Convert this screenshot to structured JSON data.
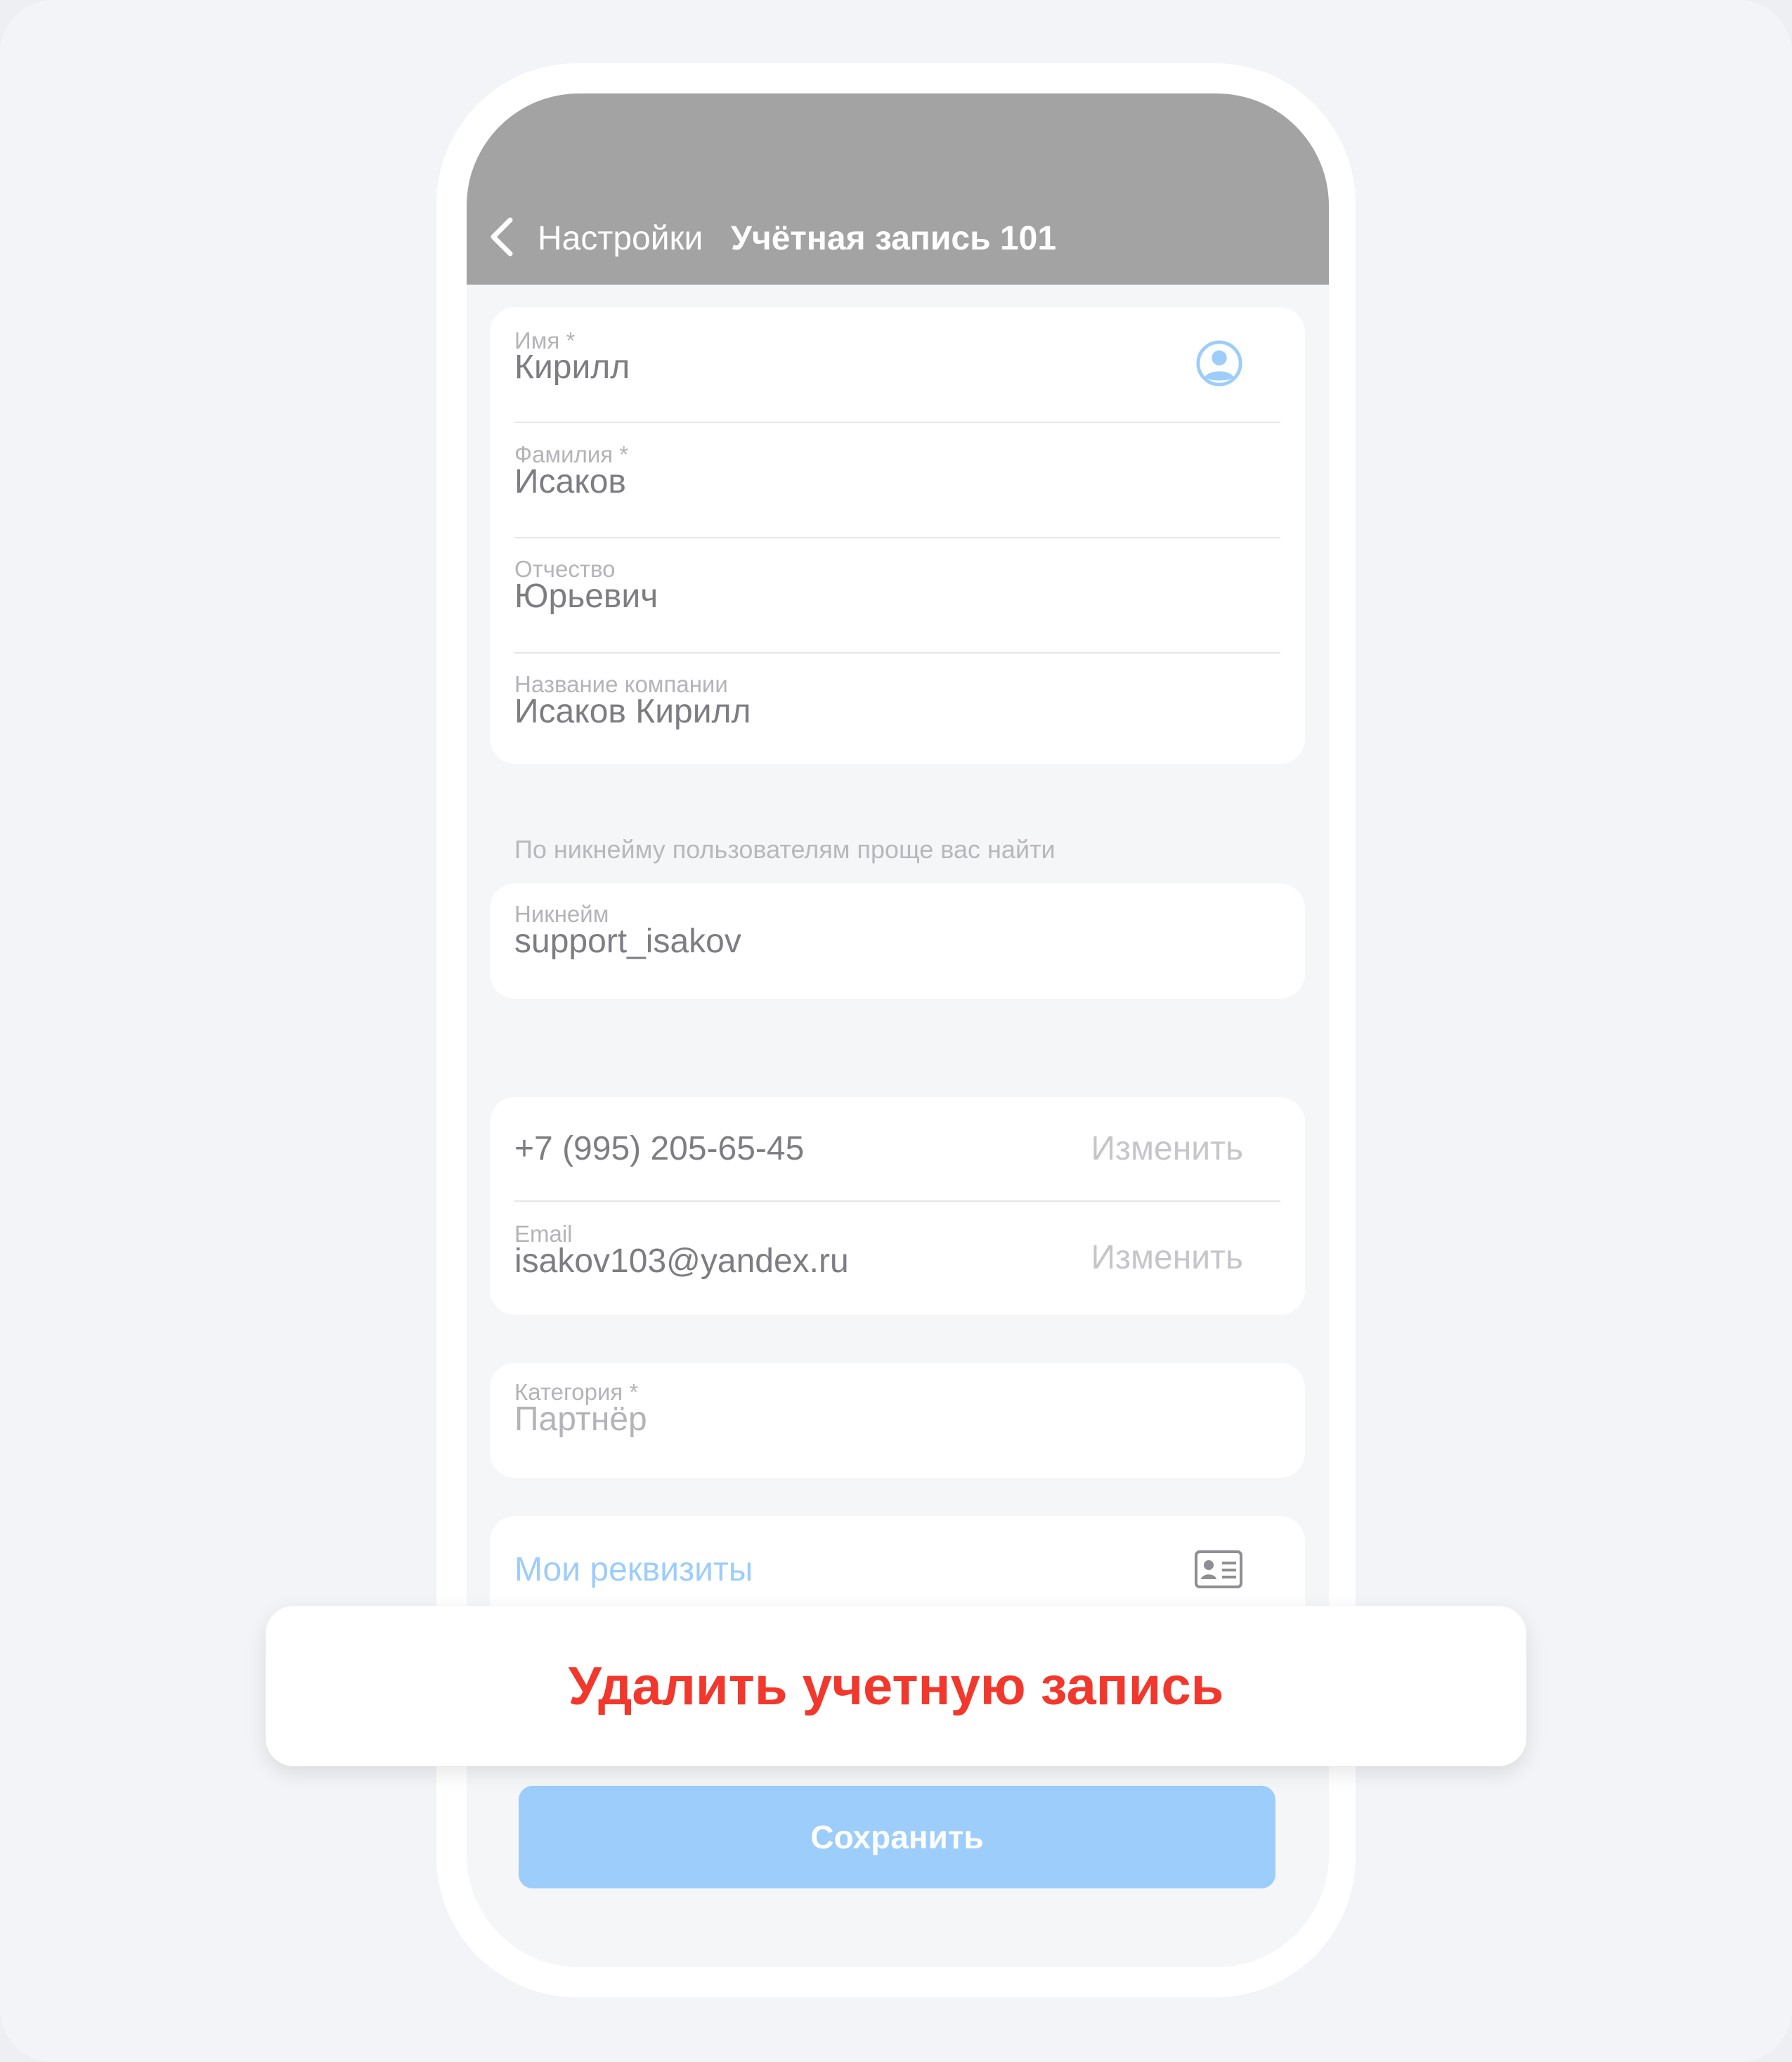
{
  "navbar": {
    "back_label": "Настройки",
    "title": "Учётная запись 101"
  },
  "profile_card": {
    "first_name": {
      "label": "Имя *",
      "value": "Кирилл"
    },
    "last_name": {
      "label": "Фамилия *",
      "value": "Исаков"
    },
    "patronymic": {
      "label": "Отчество",
      "value": "Юрьевич"
    },
    "company": {
      "label": "Название компании",
      "value": "Исаков Кирилл"
    },
    "avatar_icon": "person-circle-icon"
  },
  "nickname_hint": "По никнейму пользователям проще вас найти",
  "nickname": {
    "label": "Никнейм",
    "value": "support_isakov"
  },
  "contacts": {
    "phone": {
      "value": "+7 (995) 205-65-45",
      "action": "Изменить"
    },
    "email": {
      "label": "Email",
      "value": "isakov103@yandex.ru",
      "action": "Изменить"
    }
  },
  "category": {
    "label": "Категория *",
    "value": "Партнёр"
  },
  "requisites": {
    "label": "Мои реквизиты",
    "icon": "id-card-icon"
  },
  "delete_account": {
    "label": "Удалить учетную запись"
  },
  "save_button": {
    "label": "Сохранить"
  },
  "colors": {
    "accent": "#9ccdfb",
    "danger": "#f2382c",
    "navbar": "#a3a3a3"
  }
}
